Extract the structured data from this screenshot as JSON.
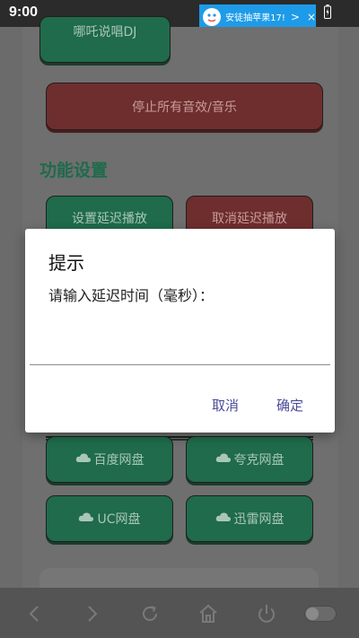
{
  "status_bar": {
    "time": "9:00",
    "ad_text": "安徒抽苹果17!",
    "ad_arrow": ">",
    "ad_close": "×"
  },
  "background": {
    "top_button": "哪吒说唱DJ",
    "stop_all_button": "停止所有音效/音乐",
    "section_title": "功能设置",
    "set_delay_button": "设置延迟播放",
    "cancel_delay_button": "取消延迟播放",
    "baidu_pan": "百度网盘",
    "quark_pan": "夸克网盘",
    "uc_pan": "UC网盘",
    "xunlei_pan": "迅雷网盘"
  },
  "dialog": {
    "title": "提示",
    "message": "请输入延迟时间（毫秒）：",
    "input_value": "",
    "cancel_label": "取消",
    "ok_label": "确定"
  },
  "navbar": {
    "icons": [
      "back-icon",
      "forward-icon",
      "refresh-icon",
      "home-icon",
      "power-icon",
      "toggle-switch"
    ]
  },
  "colors": {
    "primary_green": "#1f6b4b",
    "danger_red": "#6e2e2e",
    "dialog_button": "#4b4b9a",
    "ad_blue": "#1e9be8"
  }
}
